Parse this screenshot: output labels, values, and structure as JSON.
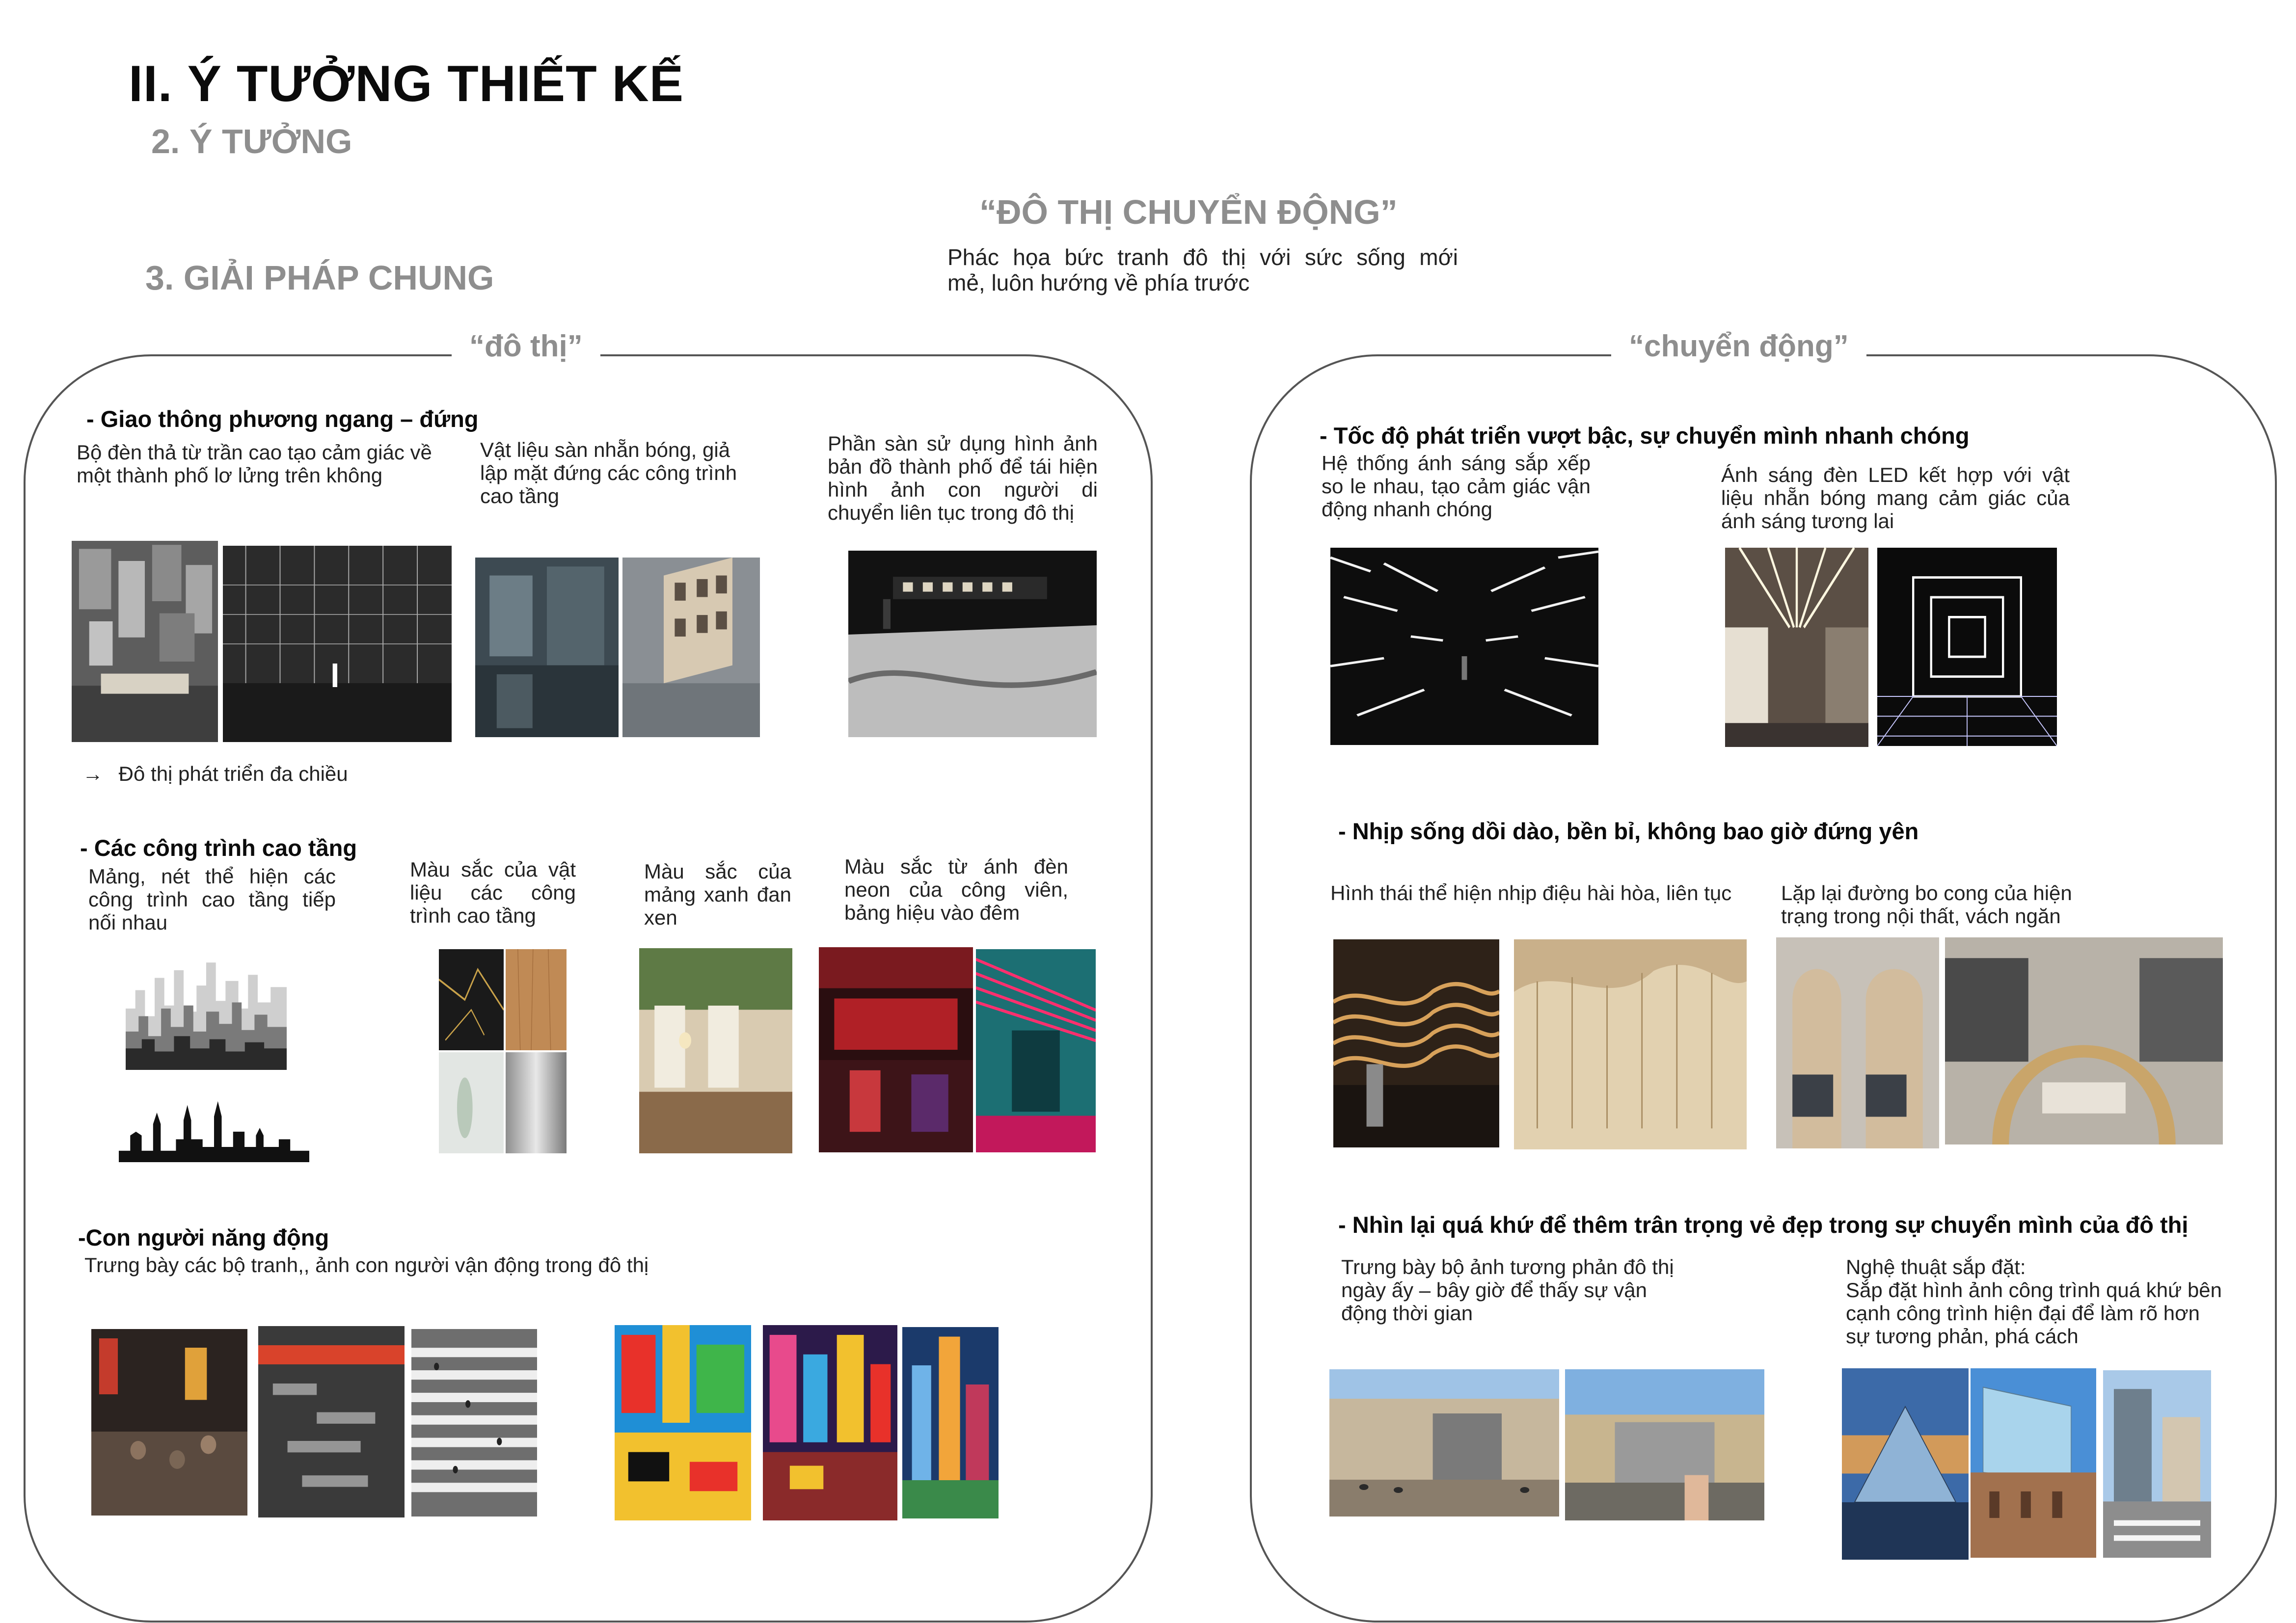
{
  "header": {
    "title": "II. Ý TƯỞNG THIẾT KẾ",
    "sub_idea": "2. Ý TƯỞNG",
    "sub_solution": "3. GIẢI PHÁP CHUNG"
  },
  "concept": {
    "title": "“ĐÔ THỊ CHUYỂN ĐỘNG”",
    "line1": "Phác họa bức tranh đô thị với sức sống mới",
    "line2": "mẻ, luôn hướng về phía trước"
  },
  "left_panel": {
    "label": "“đô thị”",
    "transport": {
      "heading": "- Giao thông phương ngang – đứng",
      "cap1": "Bộ đèn thả từ trần cao tạo cảm giác về một thành phố lơ lửng trên không",
      "cap2": "Vật liệu sàn nhẵn bóng, giả lập mặt đứng các công trình cao tầng",
      "cap3": "Phần sàn sử dụng hình ảnh bản đồ thành phố để tái hiện hình ảnh con người di chuyển liên tục trong đô thị",
      "arrow": "→",
      "conclusion": "Đô thị phát triển đa chiều"
    },
    "highrise": {
      "heading": "- Các công trình cao tầng",
      "cap1": "Mảng, nét thể hiện các công trình cao tầng tiếp nối nhau",
      "cap2": "Màu sắc của vật liệu các công trình cao tầng",
      "cap3": "Màu sắc của mảng xanh đan xen",
      "cap4": "Màu sắc từ ánh đèn neon của công viên, bảng hiệu vào đêm"
    },
    "people": {
      "heading": "-Con người năng động",
      "cap": "Trưng bày các bộ tranh,, ảnh con người vận động  trong đô thị"
    }
  },
  "right_panel": {
    "label": "“chuyển động”",
    "speed": {
      "heading": "- Tốc độ phát triển vượt bậc, sự chuyển mình nhanh chóng",
      "cap1": "Hệ thống ánh sáng sắp xếp so le nhau, tạo cảm giác vận động nhanh chóng",
      "cap2": "Ánh sáng đèn LED kết hợp với vật liệu nhẵn bóng mang cảm giác của ánh sáng tương lai"
    },
    "rhythm": {
      "heading": "- Nhịp sống dồi dào, bền bỉ, không bao giờ đứng yên",
      "cap1": "Hình thái thể hiện nhịp điệu hài hòa, liên tục",
      "cap2": "Lặp lại đường bo cong của hiện trạng trong nội thất, vách ngăn"
    },
    "past": {
      "heading": "- Nhìn lại quá khứ để thêm trân trọng vẻ đẹp trong sự chuyển mình của đô thị",
      "cap1": "Trưng bày bộ ảnh tương phản đô thị ngày ấy – bây giờ để thấy sự vận động thời gian",
      "cap2_title": "Nghệ thuật sắp đặt:",
      "cap2": "Sắp đặt hình ảnh công trình quá khứ bên cạnh công trình hiện đại để làm rõ hơn sự tương phản, phá cách"
    }
  }
}
